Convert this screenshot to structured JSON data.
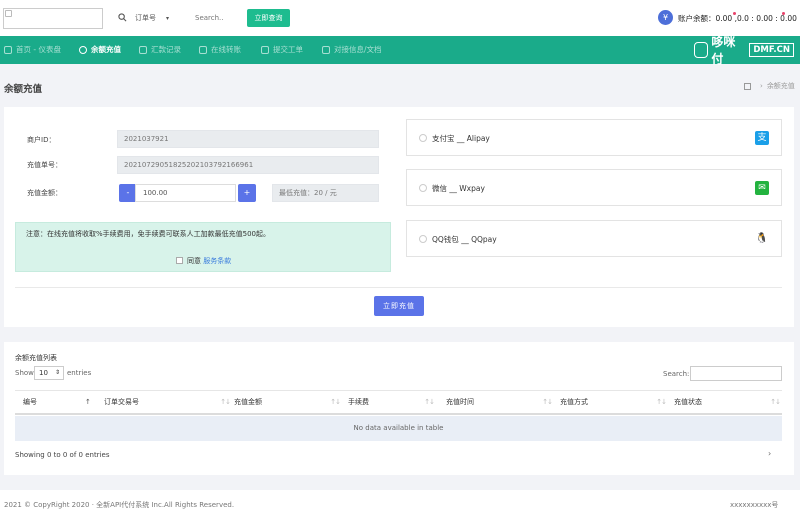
{
  "header": {
    "search_type": "订单号",
    "search_placeholder": "Search..",
    "search_button": "立即查询",
    "balance_coin": "¥",
    "balance_text": "账户余额：0.00  ,0.0 : 0.00 : 0.00"
  },
  "nav": {
    "items": [
      {
        "label": "首页 - 仪表盘",
        "icon": "home-icon"
      },
      {
        "label": "余额充值",
        "icon": "recharge-icon",
        "active": true
      },
      {
        "label": "汇款记录",
        "icon": "chart-icon"
      },
      {
        "label": "在线转账",
        "icon": "transfer-icon"
      },
      {
        "label": "提交工单",
        "icon": "ticket-icon"
      },
      {
        "label": "对接信息/文档",
        "icon": "doc-icon"
      }
    ],
    "brand_name": "哆咪付",
    "brand_domain": "DMF.CN"
  },
  "page": {
    "title": "余额充值",
    "breadcrumb_current": "余额充值"
  },
  "form": {
    "merchant_id_label": "商户ID：",
    "merchant_id_value": "2021037921",
    "order_no_label": "充值单号：",
    "order_no_value": "20210729051825202103792166961",
    "amount_label": "充值金额：",
    "minus": "-",
    "amount_value": "100.00",
    "plus": "+",
    "min_amount": "最低充值：20 / 元",
    "notice": "注意：在线充值将收取%手续费用，免手续费可联系人工加款最低充值500起。",
    "agree_text": "同意",
    "agree_link": "服务条款",
    "submit": "立即充值"
  },
  "payment_methods": [
    {
      "label": "支付宝 __ Alipay",
      "icon": "alipay-icon",
      "color": "#1a9fe8",
      "glyph": "支"
    },
    {
      "label": "微信 __ Wxpay",
      "icon": "wechat-icon",
      "color": "#23b33f",
      "glyph": "✉"
    },
    {
      "label": "QQ钱包 __ QQpay",
      "icon": "qq-icon",
      "color": "#ffffff",
      "glyph": "🐧"
    }
  ],
  "records": {
    "title": "余额充值列表",
    "show": "Show",
    "page_size": "10",
    "entries": "entries",
    "search_label": "Search:",
    "columns": [
      "编号",
      "订单交易号",
      "充值金额",
      "手续费",
      "充值时间",
      "充值方式",
      "充值状态"
    ],
    "empty": "No data available in table",
    "info": "Showing 0 to 0 of 0 entries",
    "next": "›"
  },
  "footer": {
    "copyright": "2021 © CopyRight 2020 · 全新API代付系统 Inc.All Rights Reserved.",
    "right": "xxxxxxxxxx号"
  },
  "colors": {
    "accent": "#1aab8a",
    "primary": "#5b73e8",
    "notice_bg": "#d8f3ea"
  }
}
